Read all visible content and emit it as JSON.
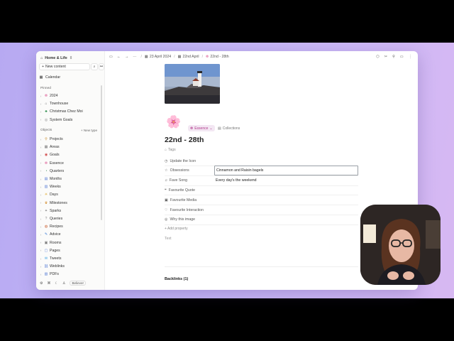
{
  "sidebar": {
    "workspace": "Home & Life",
    "new_content": "New content",
    "calendar": "Calendar",
    "pinned_heading": "Pinned",
    "pinned": [
      {
        "icon": "❁",
        "label": "2024",
        "color": "#e06c9f"
      },
      {
        "icon": "⌂",
        "label": "Townhouse",
        "color": "#666"
      },
      {
        "icon": "♣",
        "label": "Christmas Chez Moi",
        "color": "#2f8f4e"
      },
      {
        "icon": "◎",
        "label": "System Goals",
        "color": "#888"
      }
    ],
    "objects_heading": "Objects",
    "new_type": "+ New type",
    "objects": [
      {
        "icon": "⚲",
        "label": "Projects",
        "color": "#c98a2a"
      },
      {
        "icon": "▦",
        "label": "Areas",
        "color": "#7a7a7a"
      },
      {
        "icon": "◉",
        "label": "Goals",
        "color": "#d24b4b"
      },
      {
        "icon": "❁",
        "label": "Essence",
        "color": "#e06c9f"
      },
      {
        "icon": "◔",
        "label": "Quarters",
        "color": "#3b8f5a"
      },
      {
        "icon": "▤",
        "label": "Months",
        "color": "#5a7fd6"
      },
      {
        "icon": "▥",
        "label": "Weeks",
        "color": "#5a7fd6"
      },
      {
        "icon": "☀",
        "label": "Days",
        "color": "#e0a82e"
      },
      {
        "icon": "♛",
        "label": "Milestones",
        "color": "#d28b2a"
      },
      {
        "icon": "✦",
        "label": "Sparks",
        "color": "#888"
      },
      {
        "icon": "?",
        "label": "Queries",
        "color": "#888"
      },
      {
        "icon": "◍",
        "label": "Recipes",
        "color": "#c85a2a"
      },
      {
        "icon": "✎",
        "label": "Advice",
        "color": "#3a7ad6"
      },
      {
        "icon": "▣",
        "label": "Rooms",
        "color": "#7a7a7a"
      },
      {
        "icon": "▢",
        "label": "Pages",
        "color": "#5a7fd6"
      },
      {
        "icon": "✉",
        "label": "Tweets",
        "color": "#3aa0e0"
      },
      {
        "icon": "⛓",
        "label": "Weblinks",
        "color": "#5a7fd6"
      },
      {
        "icon": "▧",
        "label": "PDFs",
        "color": "#5a7fd6"
      }
    ],
    "bottom_badge": "Believer"
  },
  "breadcrumb": {
    "items": [
      "23 April 2024",
      "22nd April",
      "22nd - 28th"
    ]
  },
  "page": {
    "emoji": "🌸",
    "type_label": "Essence",
    "collections_label": "Collections",
    "title": "22nd - 28th",
    "tags_label": "Tags",
    "properties": [
      {
        "icon": "◷",
        "name": "Update the Icon",
        "value": ""
      },
      {
        "icon": "☆",
        "name": "Obsessions",
        "value": "Cinnamon and Raisin bagels"
      },
      {
        "icon": "♫",
        "name": "Fave Song",
        "value": "Every day's the weekend"
      },
      {
        "icon": "❝",
        "name": "Favourite Quote",
        "value": ""
      },
      {
        "icon": "▣",
        "name": "Favourite Media",
        "value": ""
      },
      {
        "icon": "♡",
        "name": "Favourite Interaction",
        "value": ""
      },
      {
        "icon": "◎",
        "name": "Why this image",
        "value": ""
      }
    ],
    "add_property": "+ Add property",
    "text_label": "Text",
    "backlinks": "Backlinks (1)"
  }
}
